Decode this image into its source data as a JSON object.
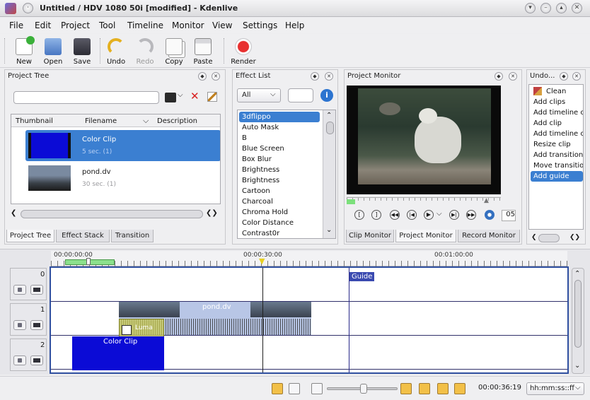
{
  "window": {
    "title": "Untitled / HDV 1080 50i [modified] - Kdenlive"
  },
  "menu": [
    "File",
    "Edit",
    "Project",
    "Tool",
    "Timeline",
    "Monitor",
    "View",
    "Settings",
    "Help"
  ],
  "toolbar": {
    "new": "New",
    "open": "Open",
    "save": "Save",
    "undo": "Undo",
    "redo": "Redo",
    "copy": "Copy",
    "paste": "Paste",
    "render": "Render"
  },
  "project_tree": {
    "title": "Project Tree",
    "columns": [
      "Thumbnail",
      "Filename",
      "Description"
    ],
    "items": [
      {
        "name": "Color Clip",
        "duration": "5 sec. (1)"
      },
      {
        "name": "pond.dv",
        "duration": "30 sec. (1)"
      }
    ],
    "tabs": [
      "Project Tree",
      "Effect Stack",
      "Transition"
    ]
  },
  "effect_list": {
    "title": "Effect List",
    "filter": "All",
    "items": [
      "3dflippo",
      "Auto Mask",
      "B",
      "Blue Screen",
      "Box Blur",
      "Brightness",
      "Brightness",
      "Cartoon",
      "Charcoal",
      "Chroma Hold",
      "Color Distance",
      "Contrast0r"
    ]
  },
  "project_monitor": {
    "title": "Project Monitor",
    "zoom": "05",
    "tabs": [
      "Clip Monitor",
      "Project Monitor",
      "Record Monitor"
    ]
  },
  "undo": {
    "title": "Undo...",
    "items": [
      "Clean",
      "Add clips",
      "Add timeline clip",
      "Add clip",
      "Add timeline clip",
      "Resize clip",
      "Add transition to",
      "Move transition",
      "Add guide"
    ]
  },
  "timeline": {
    "ruler": [
      "00:00:00:00",
      "00:00:30:00",
      "00:01:00:00"
    ],
    "tracks": [
      "0",
      "1",
      "2"
    ],
    "guide": "Guide",
    "clips": {
      "pond": "pond.dv",
      "color": "Color Clip",
      "transition": "Luma"
    }
  },
  "statusbar": {
    "timecode": "00:00:36:19",
    "format": "hh:mm:ss::ff"
  },
  "colors": {
    "selection": "#3b7fd1",
    "color_clip": "#0b0bd6",
    "guide": "#2a2a8a"
  }
}
